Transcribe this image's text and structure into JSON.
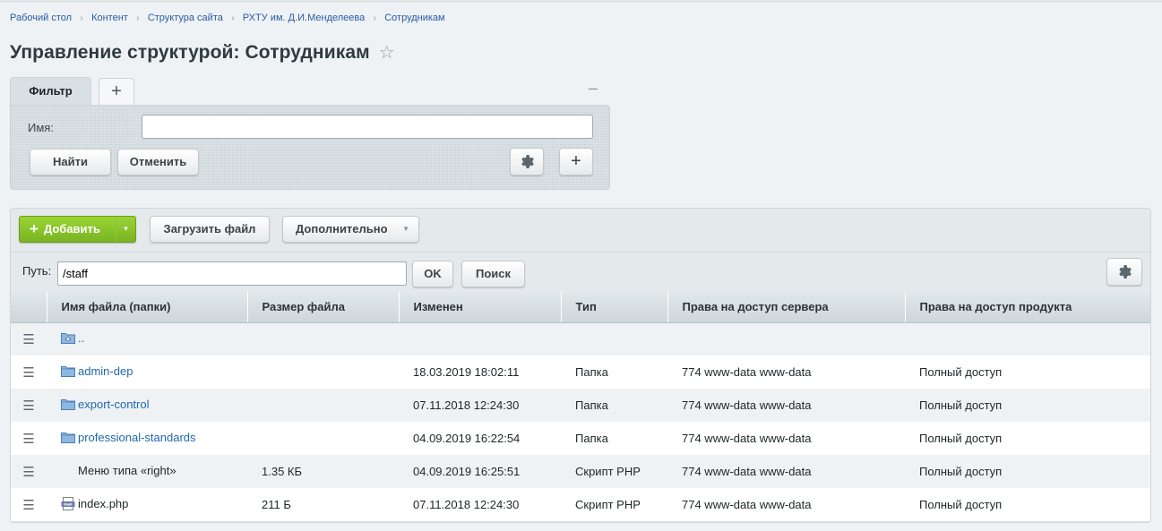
{
  "breadcrumbs": [
    "Рабочий стол",
    "Контент",
    "Структура сайта",
    "РХТУ им. Д.И.Менделеева",
    "Сотрудникам"
  ],
  "page_title": "Управление структурой: Сотрудникам",
  "filter": {
    "tab_label": "Фильтр",
    "name_label": "Имя:",
    "name_value": "",
    "find_button": "Найти",
    "cancel_button": "Отменить"
  },
  "toolbar": {
    "add_button": "Добавить",
    "upload_button": "Загрузить файл",
    "more_button": "Дополнительно"
  },
  "path": {
    "label": "Путь:",
    "value": "/staff",
    "ok_button": "OK",
    "search_button": "Поиск"
  },
  "table": {
    "columns": [
      "Имя файла (папки)",
      "Размер файла",
      "Изменен",
      "Тип",
      "Права на доступ сервера",
      "Права на доступ продукта"
    ],
    "rows": [
      {
        "icon": "folder-up-icon",
        "name": "..",
        "size": "",
        "modified": "",
        "type": "",
        "server": "",
        "product": "",
        "link": true
      },
      {
        "icon": "folder-icon",
        "name": "admin-dep",
        "size": "",
        "modified": "18.03.2019 18:02:11",
        "type": "Папка",
        "server": "774 www-data www-data",
        "product": "Полный доступ",
        "link": true
      },
      {
        "icon": "folder-icon",
        "name": "export-control",
        "size": "",
        "modified": "07.11.2018 12:24:30",
        "type": "Папка",
        "server": "774 www-data www-data",
        "product": "Полный доступ",
        "link": true
      },
      {
        "icon": "folder-icon",
        "name": "professional-standards",
        "size": "",
        "modified": "04.09.2019 16:22:54",
        "type": "Папка",
        "server": "774 www-data www-data",
        "product": "Полный доступ",
        "link": true
      },
      {
        "icon": "",
        "name": "Меню типа «right»",
        "size": "1.35 КБ",
        "modified": "04.09.2019 16:25:51",
        "type": "Скрипт PHP",
        "server": "774 www-data www-data",
        "product": "Полный доступ",
        "link": false
      },
      {
        "icon": "php-file-icon",
        "name": "index.php",
        "size": "211 Б",
        "modified": "07.11.2018 12:24:30",
        "type": "Скрипт PHP",
        "server": "774 www-data www-data",
        "product": "Полный доступ",
        "link": false
      }
    ]
  }
}
